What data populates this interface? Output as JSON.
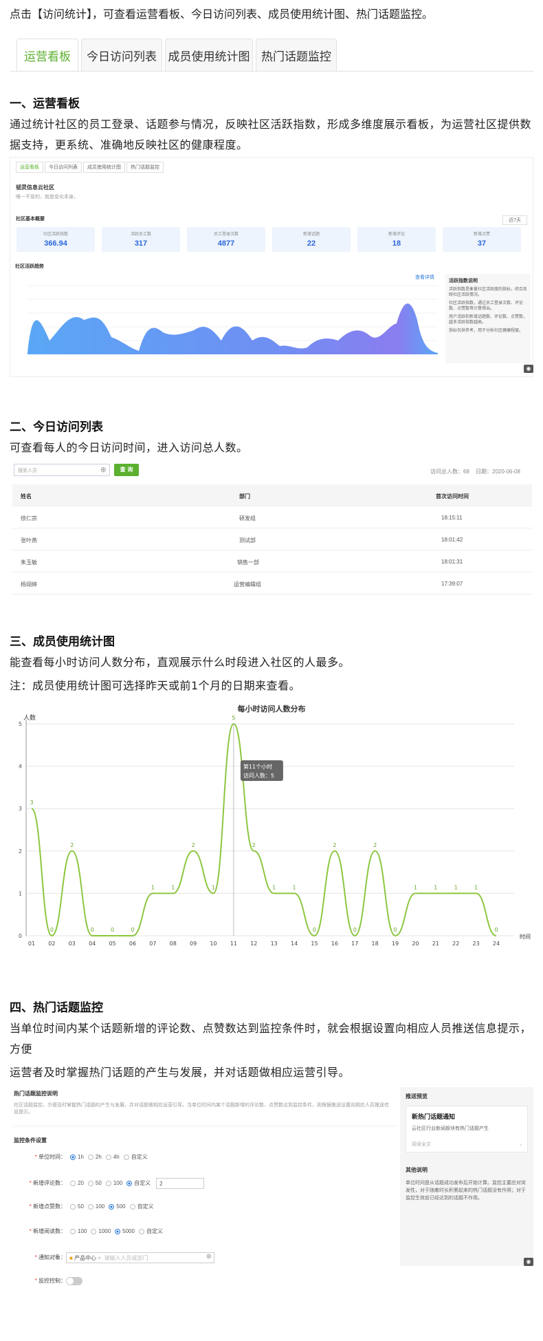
{
  "intro": "点击【访问统计】，可查看运营看板、今日访问列表、成员使用统计图、热门话题监控。",
  "tabs": [
    "运营看板",
    "今日访问列表",
    "成员使用统计图",
    "热门话题监控"
  ],
  "s1": {
    "title": "一、运营看板",
    "desc": "通过统计社区的员工登录、话题参与情况，反映社区活跃指数，形成多维度展示看板，为运营社区提供数据支持，更系统、准确地反映社区的健康程度。",
    "mini_tabs": [
      "运营看板",
      "今日访问列表",
      "成员使用统计图",
      "热门话题监控"
    ],
    "community": "韧灵信息云社区",
    "community_sub": "唯一不变的，就是变化本身。",
    "basic": "社区基本概要",
    "range": "近7天",
    "kpis": [
      {
        "l": "社区活跃指数",
        "v": "366.94"
      },
      {
        "l": "活跃员工数",
        "v": "317"
      },
      {
        "l": "员工登录次数",
        "v": "4877"
      },
      {
        "l": "新增话题",
        "v": "22"
      },
      {
        "l": "新增评论",
        "v": "18"
      },
      {
        "l": "新增点赞",
        "v": "37"
      }
    ],
    "trend": "社区活跃趋势",
    "trend_link": "查看详情",
    "side_title": "活跃指数说明",
    "side_items": [
      "活跃指数是衡量社区活跃度的指标，综合反映社区活跃情况。",
      "社区活跃指数，通过员工登录次数、评论数、点赞数等计算得出。",
      "用户活跃和新增话题数、评论数、点赞数，越多活跃指数越高。",
      "指标仅供参考，用于分析社区健康程度。"
    ]
  },
  "s2": {
    "title": "二、今日访问列表",
    "desc": "可查看每人的今日访问时间，进入访问总人数。",
    "search_ph": "搜索人员",
    "search_btn": "查 询",
    "total": "访问总人数：68",
    "date": "日期：2020-06-08",
    "cols": [
      "姓名",
      "部门",
      "首次访问时间"
    ],
    "rows": [
      [
        "徐仁宗",
        "研发组",
        "18:15:11"
      ],
      [
        "张叶燕",
        "测试部",
        "18:01:42"
      ],
      [
        "朱玉敏",
        "销售一部",
        "18:01:31"
      ],
      [
        "杨翊婷",
        "运营编辑组",
        "17:39:07"
      ]
    ]
  },
  "s3": {
    "title": "三、成员使用统计图",
    "desc": "能查看每小时访问人数分布，直观展示什么时段进入社区的人最多。",
    "note": "注：成员使用统计图可选择昨天或前1个月的日期来查看。",
    "tip1": "第11个小时",
    "tip2": "访问人数：5"
  },
  "chart_data": {
    "type": "line",
    "title": "每小时访问人数分布",
    "ylabel": "人数",
    "xlabel": "时间",
    "ylim": [
      0,
      5
    ],
    "categories": [
      "01",
      "02",
      "03",
      "04",
      "05",
      "06",
      "07",
      "08",
      "09",
      "10",
      "11",
      "12",
      "13",
      "14",
      "15",
      "16",
      "17",
      "18",
      "19",
      "20",
      "21",
      "22",
      "23",
      "24"
    ],
    "values": [
      3,
      0,
      2,
      0,
      0,
      0,
      1,
      1,
      2,
      1,
      5,
      2,
      1,
      1,
      0,
      2,
      0,
      2,
      0,
      1,
      1,
      1,
      1,
      0
    ],
    "yticks": [
      "0",
      "1",
      "2",
      "3",
      "4",
      "5"
    ],
    "color": "#8cc63f"
  },
  "s4": {
    "title": "四、热门话题监控",
    "desc1": "当单位时间内某个话题新增的评论数、点赞数达到监控条件时，就会根据设置向相应人员推送信息提示，方便",
    "desc2": "运营者及时掌握热门话题的产生与发展，并对话题做相应运营引导。",
    "panel_title": "热门话题监控说明",
    "panel_desc": "社区话题监控，方便及时掌握热门话题的产生与发展，并对话题做相应运营引导。当单位时间内某个话题新增的评论数、点赞数达到监控条件，则根据推送设置向相应人员推送信息提示。",
    "cond_title": "监控条件设置",
    "conds": [
      {
        "l": "单位时间",
        "opts": [
          "1h",
          "2h",
          "4h",
          "自定义"
        ],
        "sel": 0
      },
      {
        "l": "新增评论数",
        "opts": [
          "20",
          "50",
          "100",
          "自定义"
        ],
        "sel": 3,
        "val": "2"
      },
      {
        "l": "新增点赞数",
        "opts": [
          "50",
          "100",
          "500",
          "自定义"
        ],
        "sel": 2
      },
      {
        "l": "新增阅读数",
        "opts": [
          "100",
          "1000",
          "5000",
          "自定义"
        ],
        "sel": 2
      }
    ],
    "notify_l": "通知对象",
    "notify_tag": "产品中心",
    "notify_ph": "请输入人员或部门",
    "switch_l": "监控控制",
    "push_title": "推送预览",
    "push_card_t": "新热门话题通知",
    "push_card_d": "云社区行业新闻板块有热门话题产生",
    "push_link": "阅读全文",
    "other_title": "其他说明",
    "other_desc": "单位时间是从话题成功发布后开始计算。监控主要应对突发性，对于随着时长积累起来的热门话题没有作用；对于监控生效前已经达到的话题不作用。"
  }
}
